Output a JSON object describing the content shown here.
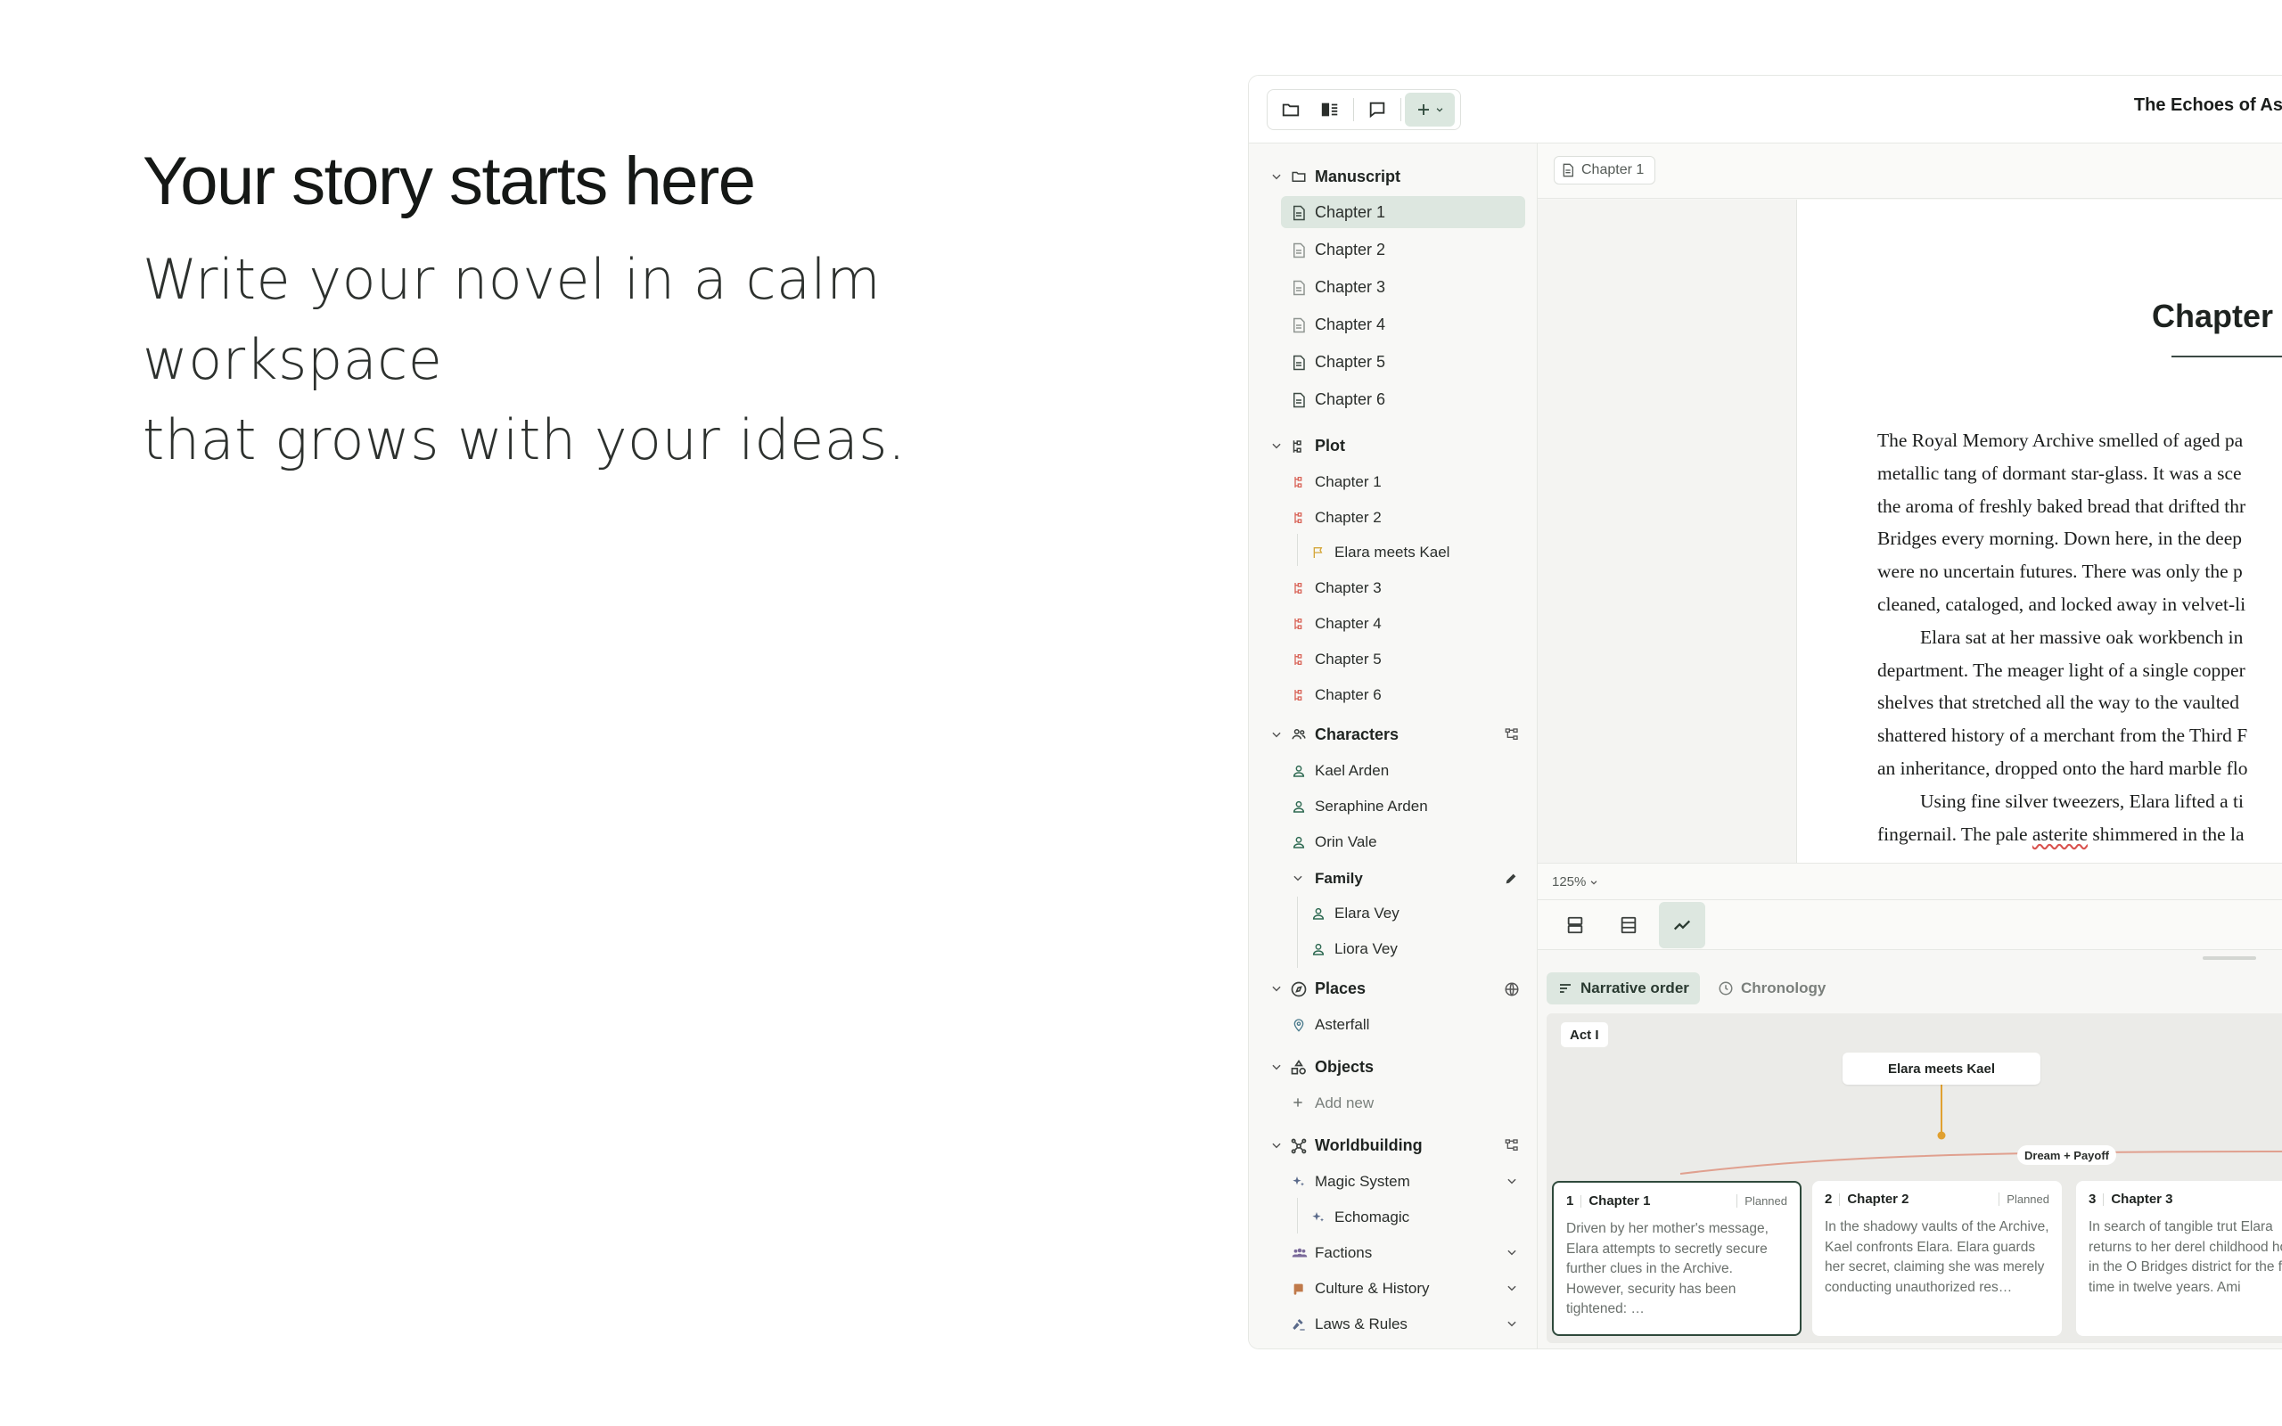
{
  "hero": {
    "headline": "Your story starts here",
    "subline_1": "Write your novel in a calm workspace",
    "subline_2": "that grows with your ideas."
  },
  "toolbar": {
    "document_title": "The Echoes of As",
    "buttons": [
      "folder-icon",
      "columns-icon",
      "comment-icon",
      "plus-icon"
    ]
  },
  "sidebar": {
    "manuscript": {
      "title": "Manuscript",
      "items": [
        "Chapter 1",
        "Chapter 2",
        "Chapter 3",
        "Chapter 4",
        "Chapter 5",
        "Chapter 6"
      ],
      "selected": "Chapter 1"
    },
    "plot": {
      "title": "Plot",
      "items": [
        "Chapter 1",
        "Chapter 2",
        "Elara meets Kael",
        "Chapter 3",
        "Chapter 4",
        "Chapter 5",
        "Chapter 6"
      ]
    },
    "characters": {
      "title": "Characters",
      "items": [
        "Kael Arden",
        "Seraphine Arden",
        "Orin Vale"
      ],
      "group": {
        "title": "Family",
        "items": [
          "Elara Vey",
          "Liora Vey"
        ]
      }
    },
    "places": {
      "title": "Places",
      "items": [
        "Asterfall"
      ]
    },
    "objects": {
      "title": "Objects",
      "add_label": "Add new"
    },
    "worldbuilding": {
      "title": "Worldbuilding",
      "items": [
        "Magic System",
        "Echomagic",
        "Factions",
        "Culture & History",
        "Laws & Rules"
      ]
    }
  },
  "editor": {
    "breadcrumb": "Chapter 1",
    "chapter_heading": "Chapter",
    "lines": [
      "The Royal Memory Archive smelled of aged pa",
      "metallic tang of dormant star-glass. It was a sce",
      "the aroma of freshly baked bread that drifted thr",
      "Bridges every morning. Down here, in the deep",
      "were no uncertain futures. There was only the p",
      "cleaned, cataloged, and locked away in velvet-li",
      "Elara sat at her massive oak workbench in",
      "department. The meager light of a single copper",
      "shelves that stretched all the way to the vaulted",
      "shattered history of a merchant from the Third F",
      "an inheritance, dropped onto the hard marble flo",
      "Using fine silver tweezers, Elara lifted a ti",
      "fingernail. The pale ",
      "asterite",
      " shimmered in the la"
    ],
    "zoom": "125%"
  },
  "plot_view": {
    "tabs": [
      "Narrative order",
      "Chronology"
    ],
    "active_tab": "Narrative order",
    "act_label": "Act I",
    "event_label": "Elara meets Kael",
    "thread_label": "Dream + Payoff",
    "cards": [
      {
        "num": "1",
        "title": "Chapter 1",
        "status": "Planned",
        "body": "Driven by her mother's message, Elara attempts to secretly secure further clues in the Archive. However, security has been tightened: …"
      },
      {
        "num": "2",
        "title": "Chapter 2",
        "status": "Planned",
        "body": "In the shadowy vaults of the Archive, Kael confronts Elara. Elara guards her secret, claiming she was merely conducting unauthorized res…"
      },
      {
        "num": "3",
        "title": "Chapter 3",
        "status": "P",
        "body": "In search of tangible trut Elara returns to her derel childhood home in the O Bridges district for the fir time in twelve years. Ami"
      }
    ]
  },
  "colors": {
    "accent_bg": "#dde7e0",
    "plot_icon": "#d9665a",
    "flag_icon": "#d4a63a",
    "timeline": "#e0a08f",
    "event_dot": "#e0a030",
    "selected_border": "#2f4a3c"
  }
}
